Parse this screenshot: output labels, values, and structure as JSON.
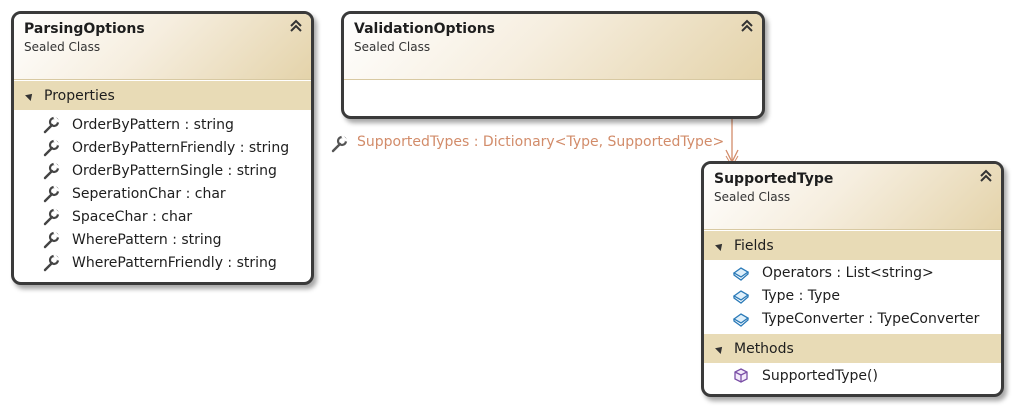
{
  "classes": {
    "parsing": {
      "name": "ParsingOptions",
      "stereotype": "Sealed Class",
      "sections": {
        "properties": {
          "label": "Properties",
          "members": [
            "OrderByPattern : string",
            "OrderByPatternFriendly : string",
            "OrderByPatternSingle : string",
            "SeperationChar : char",
            "SpaceChar : char",
            "WherePattern : string",
            "WherePatternFriendly : string"
          ]
        }
      }
    },
    "validation": {
      "name": "ValidationOptions",
      "stereotype": "Sealed Class"
    },
    "supported": {
      "name": "SupportedType",
      "stereotype": "Sealed Class",
      "sections": {
        "fields": {
          "label": "Fields",
          "members": [
            "Operators : List<string>",
            "Type : Type",
            "TypeConverter : TypeConverter"
          ]
        },
        "methods": {
          "label": "Methods",
          "members": [
            "SupportedType()"
          ]
        }
      }
    }
  },
  "association": {
    "label": "SupportedTypes : Dictionary<Type, SupportedType>",
    "color": "#d28c6a"
  },
  "icons": {
    "property": "wrench-icon",
    "field": "field-icon",
    "method": "method-cube-icon",
    "collapse": "double-chevron-up-icon",
    "section": "triangle-expander-icon"
  }
}
